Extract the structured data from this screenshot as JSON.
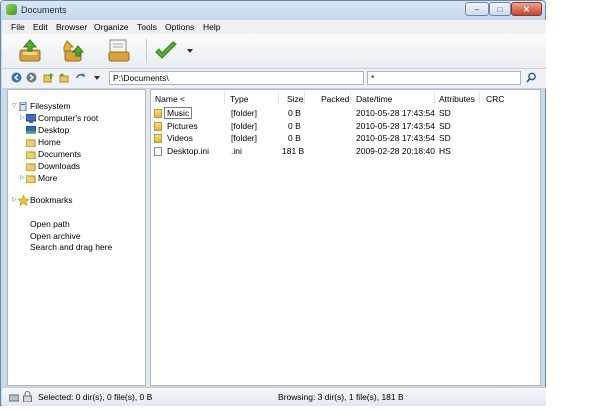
{
  "window": {
    "title": "Documents"
  },
  "window_controls": {
    "minimize": "–",
    "maximize": "□",
    "close": "✕"
  },
  "menu": [
    "File",
    "Edit",
    "Browser",
    "Organize",
    "Tools",
    "Options",
    "Help"
  ],
  "toolbar": {
    "buttons": [
      {
        "icon": "add-archive-icon"
      },
      {
        "icon": "extract-icon"
      },
      {
        "icon": "test-archive-icon"
      },
      {
        "icon": "checkmark-icon"
      },
      {
        "icon": "dropdown-arrow-icon"
      }
    ]
  },
  "address": {
    "path": "P:\\Documents\\",
    "filter": "*",
    "search_icon": "search-icon"
  },
  "sidebar": {
    "tree": [
      {
        "label": "Filesystem",
        "icon": "filesystem-icon",
        "level": 0,
        "expander": "▽"
      },
      {
        "label": "Computer's root",
        "icon": "computer-icon",
        "level": 1,
        "expander": "▷"
      },
      {
        "label": "Desktop",
        "icon": "desktop-icon",
        "level": 1,
        "expander": ""
      },
      {
        "label": "Home",
        "icon": "folder-icon",
        "level": 1,
        "expander": ""
      },
      {
        "label": "Documents",
        "icon": "folder-icon",
        "level": 1,
        "expander": ""
      },
      {
        "label": "Downloads",
        "icon": "folder-icon",
        "level": 1,
        "expander": ""
      },
      {
        "label": "More",
        "icon": "folder-icon",
        "level": 1,
        "expander": "▷"
      }
    ],
    "bookmarks": {
      "label": "Bookmarks",
      "icon": "star-icon",
      "expander": "▷"
    },
    "links": [
      "Open path",
      "Open archive",
      "Search and drag here"
    ]
  },
  "file_list": {
    "columns": [
      "Name <",
      "Type",
      "Size",
      "Packed",
      "Date/time",
      "Attributes",
      "CRC"
    ],
    "rows": [
      {
        "name": "Music",
        "type": "[folder]",
        "size": "0 B",
        "packed": "",
        "datetime": "2010-05-28 17:43:54",
        "attributes": "SD",
        "crc": "",
        "icon": "folder-icon"
      },
      {
        "name": "Pictures",
        "type": "[folder]",
        "size": "0 B",
        "packed": "",
        "datetime": "2010-05-28 17:43:54",
        "attributes": "SD",
        "crc": "",
        "icon": "folder-icon"
      },
      {
        "name": "Videos",
        "type": "[folder]",
        "size": "0 B",
        "packed": "",
        "datetime": "2010-05-28 17:43:54",
        "attributes": "SD",
        "crc": "",
        "icon": "folder-icon"
      },
      {
        "name": "Desktop.ini",
        "type": ".ini",
        "size": "181 B",
        "packed": "",
        "datetime": "2009-02-28 20:18:40",
        "attributes": "HS",
        "crc": "",
        "icon": "file-icon"
      }
    ]
  },
  "status": {
    "selected": "Selected: 0 dir(s), 0 file(s), 0 B",
    "browsing": "Browsing: 3 dir(s), 1 file(s), 181 B"
  }
}
